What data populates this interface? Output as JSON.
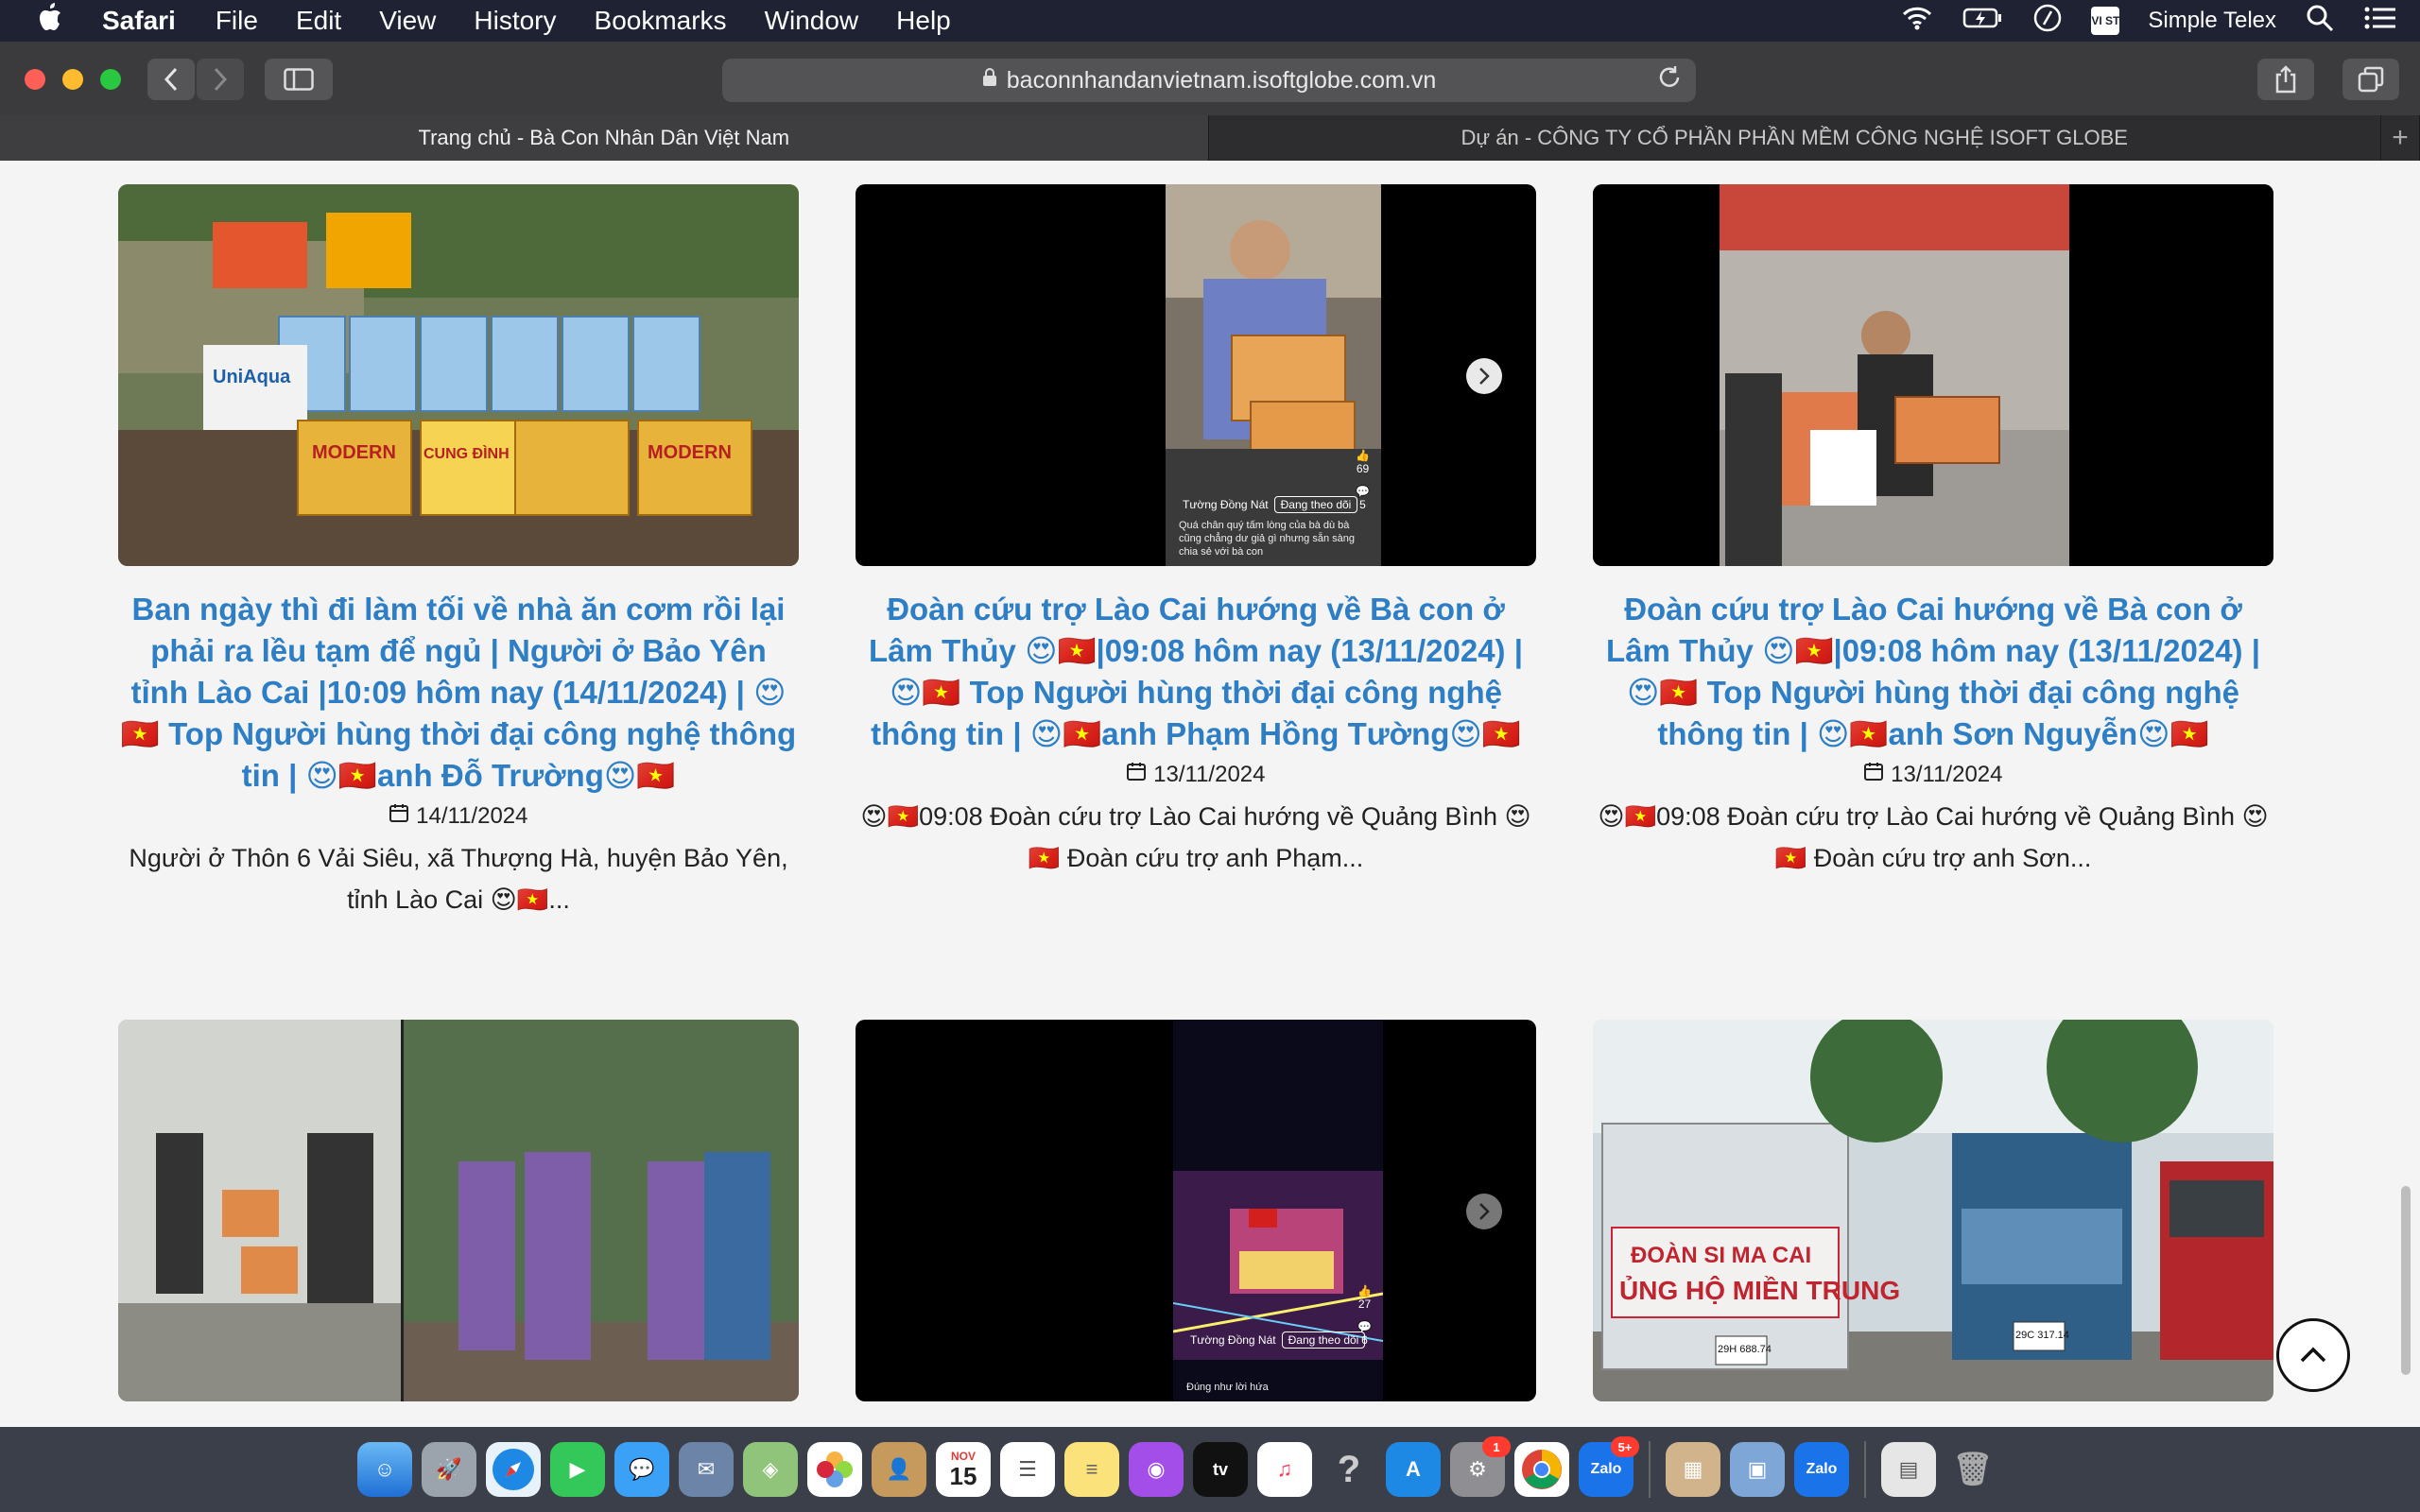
{
  "menubar": {
    "apple": "",
    "app": "Safari",
    "items": [
      "File",
      "Edit",
      "View",
      "History",
      "Bookmarks",
      "Window",
      "Help"
    ],
    "input_method": "Simple Telex",
    "vist_icon_text": "VI ST"
  },
  "browser": {
    "url": "baconnhandanvietnam.isoftglobe.com.vn",
    "tabs": [
      {
        "label": "Trang chủ - Bà Con Nhân Dân Việt Nam",
        "active": true
      },
      {
        "label": "Dự án - CÔNG TY CỔ PHẦN PHẦN MỀM CÔNG NGHỆ ISOFT GLOBE",
        "active": false
      }
    ],
    "new_tab": "+"
  },
  "posts": [
    {
      "title": "Ban ngày thì đi làm tối về nhà ăn cơm rồi lại phải ra lều tạm để ngủ | Người ở Bảo Yên tỉnh Lào Cai |10:09 hôm nay (14/11/2024) | 😍🇻🇳 Top Người hùng thời đại công nghệ thông tin | 😍🇻🇳anh Đỗ Trường😍🇻🇳",
      "date": "14/11/2024",
      "excerpt": "Người ở Thôn 6 Vải Siêu, xã Thượng Hà, huyện Bảo Yên, tỉnh Lào Cai 😍🇻🇳...",
      "thumb_labels": [
        "UniAqua",
        "MODERN",
        "CUNG ĐÌNH"
      ]
    },
    {
      "title": "Đoàn cứu trợ Lào Cai hướng về Bà con ở Lâm Thủy 😍🇻🇳|09:08 hôm nay (13/11/2024) |😍🇻🇳 Top Người hùng thời đại công nghệ thông tin | 😍🇻🇳anh Phạm Hồng Tường😍🇻🇳",
      "date": "13/11/2024",
      "excerpt": "😍🇻🇳09:08 Đoàn cứu trợ Lào Cai hướng về Quảng Bình 😍🇻🇳 Đoàn cứu trợ anh Phạm...",
      "tiktok": {
        "user": "Tường Đồng Nát",
        "follow": "Đang theo dõi",
        "likes": "69",
        "comments": "5",
        "caption": "Quá chân quý tấm lòng của bà dù bà cũng chẳng dư giả gì nhưng sẵn sàng chia sẻ với bà con"
      }
    },
    {
      "title": "Đoàn cứu trợ Lào Cai hướng về Bà con ở Lâm Thủy 😍🇻🇳|09:08 hôm nay (13/11/2024) |😍🇻🇳 Top Người hùng thời đại công nghệ thông tin | 😍🇻🇳anh Sơn Nguyễn😍🇻🇳",
      "date": "13/11/2024",
      "excerpt": "😍🇻🇳09:08 Đoàn cứu trợ Lào Cai hướng về Quảng Bình 😍🇻🇳 Đoàn cứu trợ anh Sơn..."
    },
    {
      "title": "",
      "date": "",
      "excerpt": ""
    },
    {
      "tiktok": {
        "user": "Tường Đồng Nát",
        "follow": "Đang theo dõi",
        "likes": "27",
        "comments": "6",
        "caption": "Đúng như lời hứa"
      }
    },
    {
      "banner_line1": "ĐOÀN SI MA CAI",
      "banner_line2": "ỦNG HỘ MIỀN TRUNG",
      "plate1": "29H 688.74",
      "plate2": "29C 317.14"
    }
  ],
  "scroll_top_icon": "chevron-up",
  "dock": {
    "calendar_month": "NOV",
    "calendar_day": "15",
    "tv_label": "tv",
    "help_label": "?",
    "zalo_label": "Zalo",
    "settings_badge": "1",
    "zalo_badge": "5+"
  },
  "colors": {
    "title_blue": "#2d7ec4",
    "page_bg": "#f4f4f4",
    "menubar_bg": "#1e2233"
  }
}
